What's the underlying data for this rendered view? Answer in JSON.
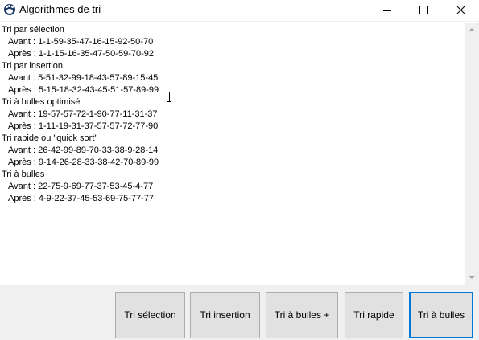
{
  "window": {
    "title": "Algorithmes de tri",
    "icon": "paw-icon",
    "controls": [
      "minimize-icon",
      "maximize-icon",
      "close-icon"
    ]
  },
  "output": {
    "sections": [
      {
        "title": "Tri par sélection",
        "before": "Avant : 1-1-59-35-47-16-15-92-50-70",
        "after": "Après : 1-1-15-16-35-47-50-59-70-92"
      },
      {
        "title": "Tri par insertion",
        "before": "Avant : 5-51-32-99-18-43-57-89-15-45",
        "after": "Après : 5-15-18-32-43-45-51-57-89-99"
      },
      {
        "title": "Tri à bulles optimisé",
        "before": "Avant : 19-57-57-72-1-90-77-11-31-37",
        "after": "Après : 1-11-19-31-37-57-57-72-77-90"
      },
      {
        "title": "Tri rapide ou \"quick sort\"",
        "before": "Avant : 26-42-99-89-70-33-38-9-28-14",
        "after": "Après : 9-14-26-28-33-38-42-70-89-99"
      },
      {
        "title": "Tri à bulles",
        "before": "Avant : 22-75-9-69-77-37-53-45-4-77",
        "after": "Après : 4-9-22-37-45-53-69-75-77-77"
      }
    ]
  },
  "buttons": [
    {
      "label": "Tri sélection"
    },
    {
      "label": "Tri insertion"
    },
    {
      "label": "Tri à bulles +"
    },
    {
      "label": "Tri rapide"
    },
    {
      "label": "Tri à bulles",
      "focused": true
    }
  ],
  "colors": {
    "focus_border": "#0078d7",
    "button_bg": "#e1e1e1",
    "window_bg": "#f0f0f0"
  }
}
